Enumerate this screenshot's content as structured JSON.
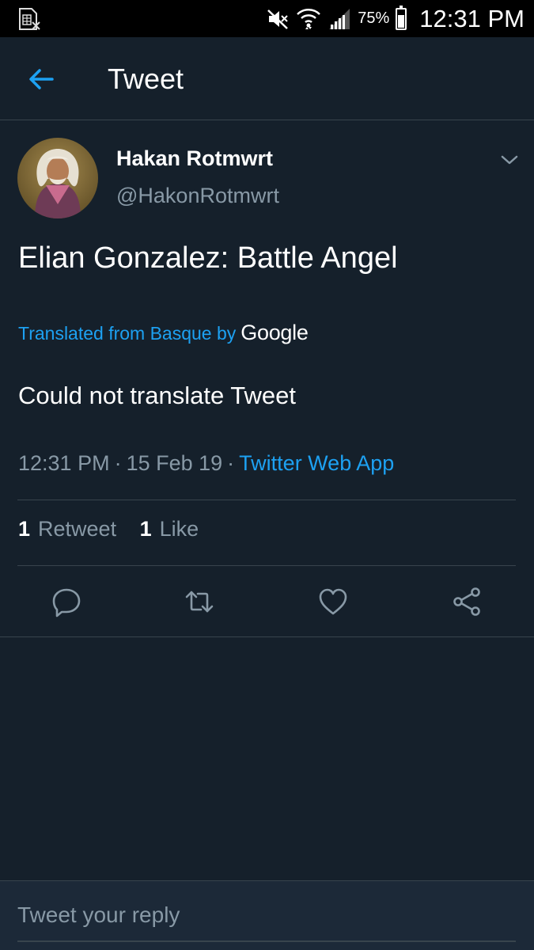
{
  "status_bar": {
    "time": "12:31 PM",
    "battery_percent": "75%",
    "battery_level": 0.75,
    "icons": [
      "sim-card-icon",
      "mute-icon",
      "wifi-icon",
      "signal-icon",
      "battery-icon"
    ]
  },
  "header": {
    "title": "Tweet",
    "back_icon": "arrow-left-icon"
  },
  "tweet": {
    "author_name": "Hakan Rotmwrt",
    "author_handle": "@HakonRotmwrt",
    "text": "Elian Gonzalez: Battle Angel",
    "translated_from": "Translated from Basque by",
    "translator": "Google",
    "translation": "Could not translate Tweet",
    "time": "12:31 PM",
    "meta_separator": "·",
    "date": "15 Feb 19",
    "source": "Twitter Web App",
    "retweet_count": "1",
    "retweet_label": "Retweet",
    "like_count": "1",
    "like_label": "Like"
  },
  "actions": [
    "reply-icon",
    "retweet-icon",
    "like-icon",
    "share-icon"
  ],
  "reply": {
    "placeholder": "Tweet your reply"
  },
  "colors": {
    "background": "#15202b",
    "accent": "#1da1f2",
    "muted": "#8899a6",
    "divider": "#38444d"
  }
}
